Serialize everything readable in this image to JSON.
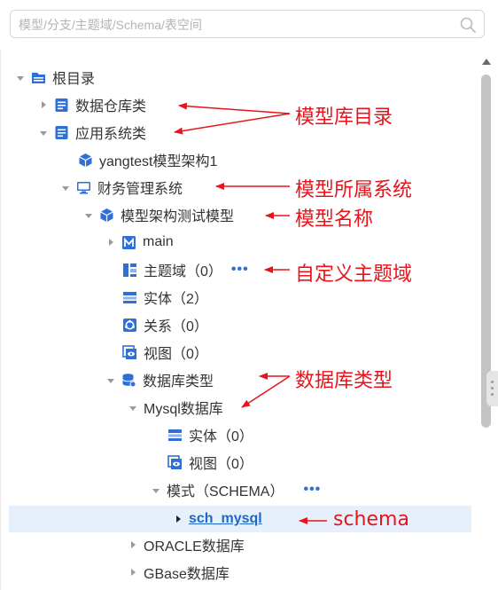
{
  "search": {
    "placeholder": "模型/分支/主题域/Schema/表空间"
  },
  "tree": {
    "root": "根目录",
    "warehouse": "数据仓库类",
    "app_systems": "应用系统类",
    "yangtest": "yangtest模型架构1",
    "finance": "财务管理系统",
    "test_model": "模型架构测试模型",
    "main": "main",
    "subject_area": "主题域（0）",
    "entity": "实体（2）",
    "relation": "关系（0）",
    "view": "视图（0）",
    "db_type": "数据库类型",
    "mysql": "Mysql数据库",
    "mysql_entity": "实体（0）",
    "mysql_view": "视图（0）",
    "schema_folder": "模式（SCHEMA）",
    "sch_mysql": "sch_mysql",
    "oracle": "ORACLE数据库",
    "gbase": "GBase数据库",
    "more": "•••"
  },
  "annotations": {
    "catalog": "模型库目录",
    "owner_system": "模型所属系统",
    "model_name": "模型名称",
    "custom_subject": "自定义主题域",
    "db_type": "数据库类型",
    "schema": "schema"
  },
  "colors": {
    "icon_blue": "#2f6fd8",
    "annotation_red": "#e8141b",
    "selection_bg": "#e6f0fb"
  }
}
